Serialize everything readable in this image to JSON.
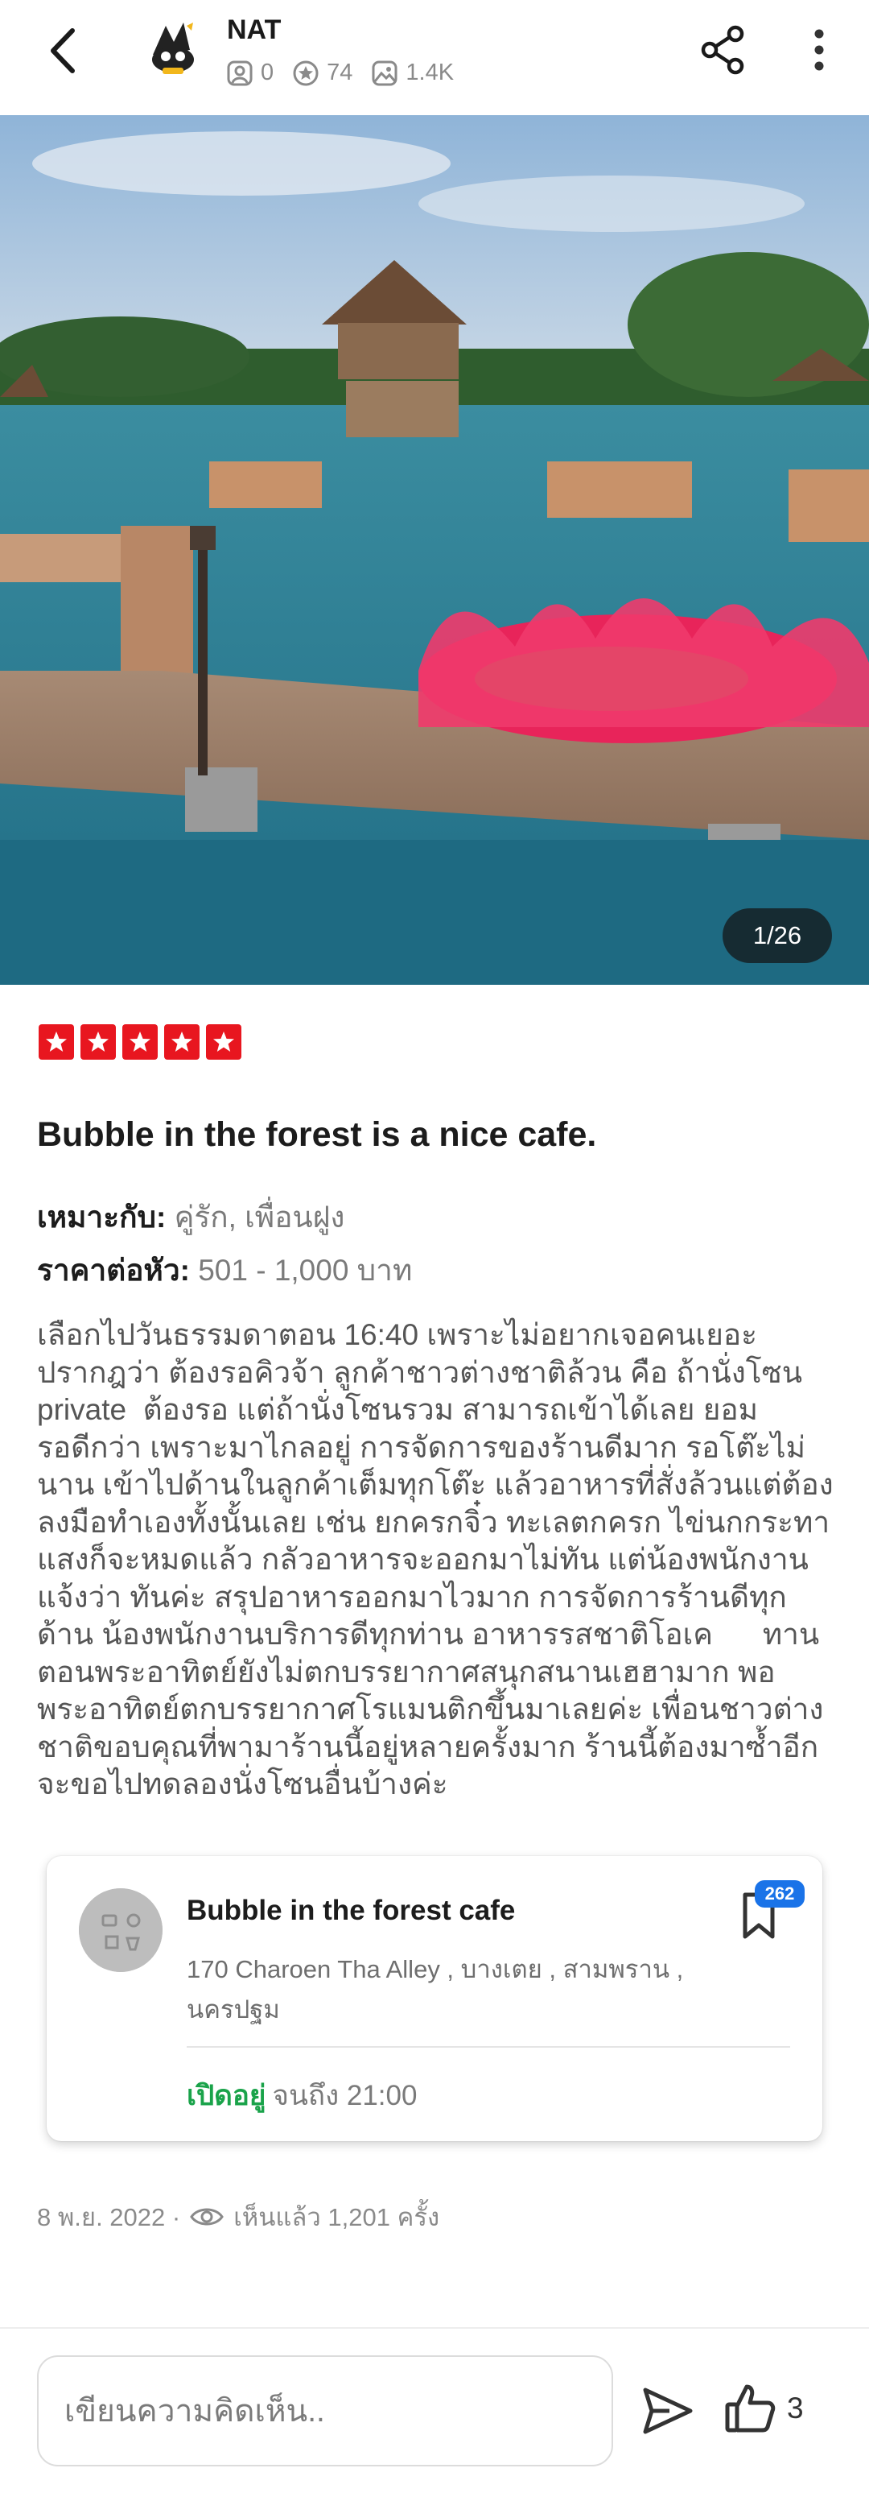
{
  "header": {
    "user_name": "NAT",
    "stats": [
      {
        "icon": "person-icon",
        "value": "0"
      },
      {
        "icon": "star-icon",
        "value": "74"
      },
      {
        "icon": "image-icon",
        "value": "1.4K"
      }
    ]
  },
  "photo": {
    "counter": "1/26"
  },
  "review": {
    "rating": 5,
    "title": "Bubble in the forest is a nice cafe.",
    "suitable_label": "เหมาะกับ:",
    "suitable_value": " คู่รัก, เพื่อนฝูง",
    "price_label": "ราคาต่อหัว:",
    "price_value": " 501 - 1,000 บาท",
    "body": "เลือกไปวันธรรมดาตอน 16:40 เพราะไม่อยากเจอคนเยอะ\nปรากฎว่า ต้องรอคิวจ้า ลูกค้าชาวต่างชาติล้วน คือ ถ้านั่งโซน\nprivate  ต้องรอ แต่ถ้านั่งโซนรวม สามารถเข้าได้เลย ยอม\nรอดีกว่า เพราะมาไกลอยู่ การจัดการของร้านดีมาก รอโต๊ะไม่\nนาน เข้าไปด้านในลูกค้าเต็มทุกโต๊ะ แล้วอาหารที่สั่งล้วนแต่ต้อง\nลงมือทำเองทั้งนั้นเลย เช่น ยกครกจิ๋ว ทะเลตกครก ไข่นกกระทา\nแสงก็จะหมดแล้ว กลัวอาหารจะออกมาไม่ทัน แต่น้องพนักงาน\nแจ้งว่า ทันค่ะ สรุปอาหารออกมาไวมาก การจัดการร้านดีทุก\nด้าน น้องพนักงานบริการดีทุกท่าน อาหารรสชาติโอเค      ทาน\nตอนพระอาทิตย์ยังไม่ตกบรรยากาศสนุกสนานเฮฮามาก พอ\nพระอาทิตย์ตกบรรยากาศโรแมนติกขึ้นมาเลยค่ะ เพื่อนชาวต่าง\nชาติขอบคุณที่พามาร้านนี้อยู่หลายครั้งมาก ร้านนี้ต้องมาซ้ำอีก\nจะขอไปทดลองนั่งโซนอื่นบ้างค่ะ"
  },
  "place": {
    "name": "Bubble in the forest cafe",
    "address": "170 Charoen Tha Alley , บางเตย , สามพราน ,\nนครปฐม",
    "bookmark_count": "262",
    "open_label": "เปิดอยู่",
    "hours": "จนถึง 21:00"
  },
  "post_meta": {
    "date": "8 พ.ย. 2022 ·",
    "views": "เห็นแล้ว 1,201 ครั้ง"
  },
  "bottom_bar": {
    "comment_placeholder": "เขียนความคิดเห็น..",
    "like_count": "3"
  },
  "colors": {
    "star_red": "#e8161f",
    "open_green": "#1aa34a",
    "badge_blue": "#1a73e8"
  }
}
